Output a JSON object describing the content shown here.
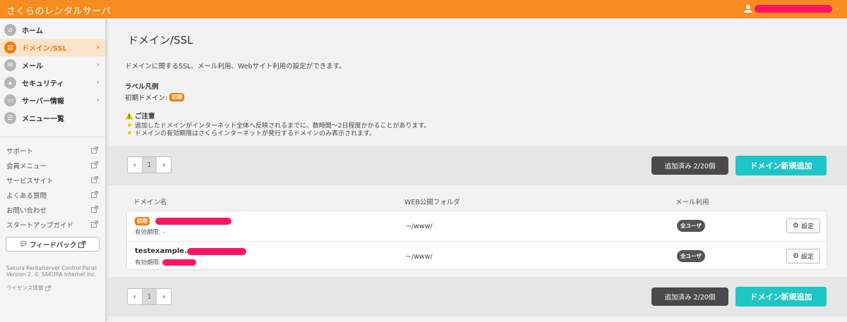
{
  "header": {
    "brand": "さくらのレンタルサーバ",
    "user_icon": "user-icon",
    "caret": "⌄"
  },
  "sidebar": {
    "nav": [
      {
        "label": "ホーム",
        "icon": "home-icon"
      },
      {
        "label": "ドメイン/SSL",
        "icon": "domain-icon",
        "active": true
      },
      {
        "label": "メール",
        "icon": "mail-icon"
      },
      {
        "label": "セキュリティ",
        "icon": "lock-icon"
      },
      {
        "label": "サーバー情報",
        "icon": "server-icon"
      },
      {
        "label": "メニュー一覧",
        "icon": "list-icon"
      }
    ],
    "links": [
      "サポート",
      "会員メニュー",
      "サービスサイト",
      "よくある質問",
      "お問い合わせ",
      "スタートアップガイド"
    ],
    "feedback_label": "フィードバック",
    "copyright_line1": "Sakura Rentalserver Control Panel",
    "copyright_line2": "Version 2. © SAKURA Internet Inc.",
    "license_label": "ライセンス情報"
  },
  "main": {
    "title": "ドメイン/SSL",
    "description": "ドメインに関するSSL、メール利用、Webサイト利用の設定ができます。",
    "legend_title": "ラベル凡例",
    "legend_label": "初期ドメイン:",
    "legend_badge": "初期",
    "notice_title": "ご注意",
    "notices": [
      "追加したドメインがインターネット全体へ反映されるまでに、数時間〜2日程度かかることがあります。",
      "ドメインの有効期限はさくらインターネットが発行するドメインのみ表示されます。"
    ],
    "pager": {
      "prev": "‹",
      "current": "1",
      "next": "›"
    },
    "count_label": "追加済み 2/20個",
    "add_label": "ドメイン新規追加",
    "columns": [
      "ドメイン名",
      "WEB公開フォルダ",
      "メール利用"
    ],
    "rows": [
      {
        "badge": "初期",
        "domain": "",
        "expiry_label": "有効期限: -",
        "folder": "~/www/",
        "mail": "全ユーザ",
        "action": "設定"
      },
      {
        "badge": "",
        "domain": "testexample.",
        "expiry_label": "有効期限:",
        "folder": "~/www/",
        "mail": "全ユーザ",
        "action": "設定"
      }
    ],
    "colors": {
      "accent": "#f68b1f",
      "add_button": "#1ec6c6",
      "redaction": "#ff1464"
    }
  }
}
